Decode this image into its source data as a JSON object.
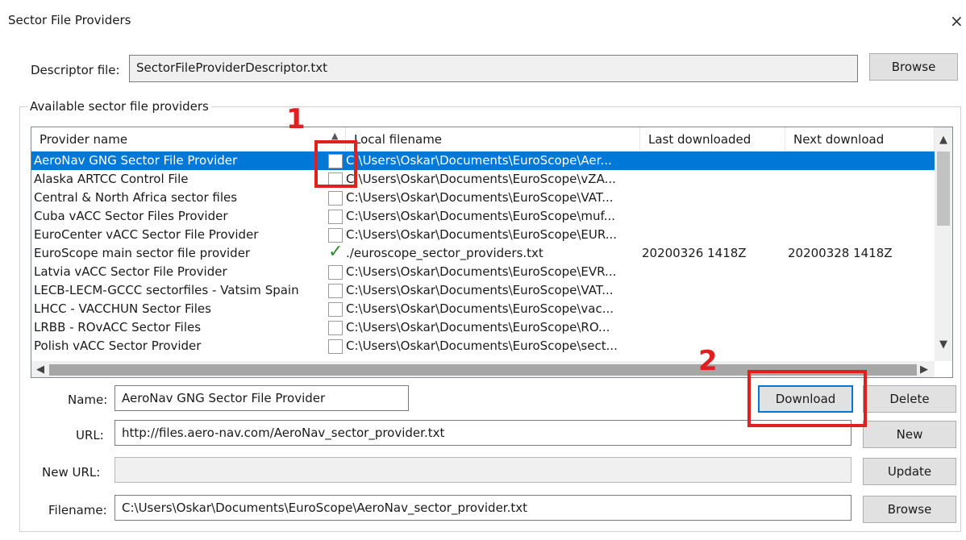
{
  "window": {
    "title": "Sector File Providers",
    "close_glyph": "×"
  },
  "descriptor": {
    "label": "Descriptor file:",
    "value": "SectorFileProviderDescriptor.txt",
    "browse_label": "Browse"
  },
  "group": {
    "title": "Available sector file providers"
  },
  "list": {
    "columns": [
      "Provider name",
      "Local filename",
      "Last downloaded",
      "Next download"
    ],
    "rows": [
      {
        "name": "AeroNav GNG Sector File Provider",
        "checked": false,
        "local": "C:\\Users\\Oskar\\Documents\\EuroScope\\Aer...",
        "last": "",
        "next": "",
        "selected": true
      },
      {
        "name": "Alaska ARTCC Control File",
        "checked": false,
        "local": "C:\\Users\\Oskar\\Documents\\EuroScope\\vZA...",
        "last": "",
        "next": ""
      },
      {
        "name": "Central & North Africa sector files",
        "checked": false,
        "local": "C:\\Users\\Oskar\\Documents\\EuroScope\\VAT...",
        "last": "",
        "next": ""
      },
      {
        "name": "Cuba vACC Sector Files Provider",
        "checked": false,
        "local": "C:\\Users\\Oskar\\Documents\\EuroScope\\muf...",
        "last": "",
        "next": ""
      },
      {
        "name": "EuroCenter vACC Sector File Provider",
        "checked": false,
        "local": "C:\\Users\\Oskar\\Documents\\EuroScope\\EUR...",
        "last": "",
        "next": ""
      },
      {
        "name": "EuroScope main sector file provider",
        "checked": true,
        "local": "./euroscope_sector_providers.txt",
        "last": "20200326 1418Z",
        "next": "20200328 1418Z"
      },
      {
        "name": "Latvia vACC Sector File Provider",
        "checked": false,
        "local": "C:\\Users\\Oskar\\Documents\\EuroScope\\EVR...",
        "last": "",
        "next": ""
      },
      {
        "name": "LECB-LECM-GCCC sectorfiles - Vatsim Spain",
        "checked": false,
        "local": "C:\\Users\\Oskar\\Documents\\EuroScope\\VAT...",
        "last": "",
        "next": ""
      },
      {
        "name": "LHCC - VACCHUN Sector Files",
        "checked": false,
        "local": "C:\\Users\\Oskar\\Documents\\EuroScope\\vac...",
        "last": "",
        "next": ""
      },
      {
        "name": "LRBB - ROvACC Sector Files",
        "checked": false,
        "local": "C:\\Users\\Oskar\\Documents\\EuroScope\\RO...",
        "last": "",
        "next": ""
      },
      {
        "name": "Polish vACC Sector Provider",
        "checked": false,
        "local": "C:\\Users\\Oskar\\Documents\\EuroScope\\sect...",
        "last": "",
        "next": ""
      }
    ]
  },
  "form": {
    "name_label": "Name:",
    "name_value": "AeroNav GNG Sector File Provider",
    "url_label": "URL:",
    "url_value": "http://files.aero-nav.com/AeroNav_sector_provider.txt",
    "newurl_label": "New URL:",
    "newurl_value": "",
    "filename_label": "Filename:",
    "filename_value": "C:\\Users\\Oskar\\Documents\\EuroScope\\AeroNav_sector_provider.txt"
  },
  "buttons": {
    "download": "Download",
    "delete": "Delete",
    "new": "New",
    "update": "Update",
    "browse": "Browse"
  },
  "annotations": {
    "one": "1",
    "two": "2"
  },
  "colors": {
    "selection": "#0078d7",
    "annotation": "#e02020",
    "check": "#2e8b2e"
  }
}
